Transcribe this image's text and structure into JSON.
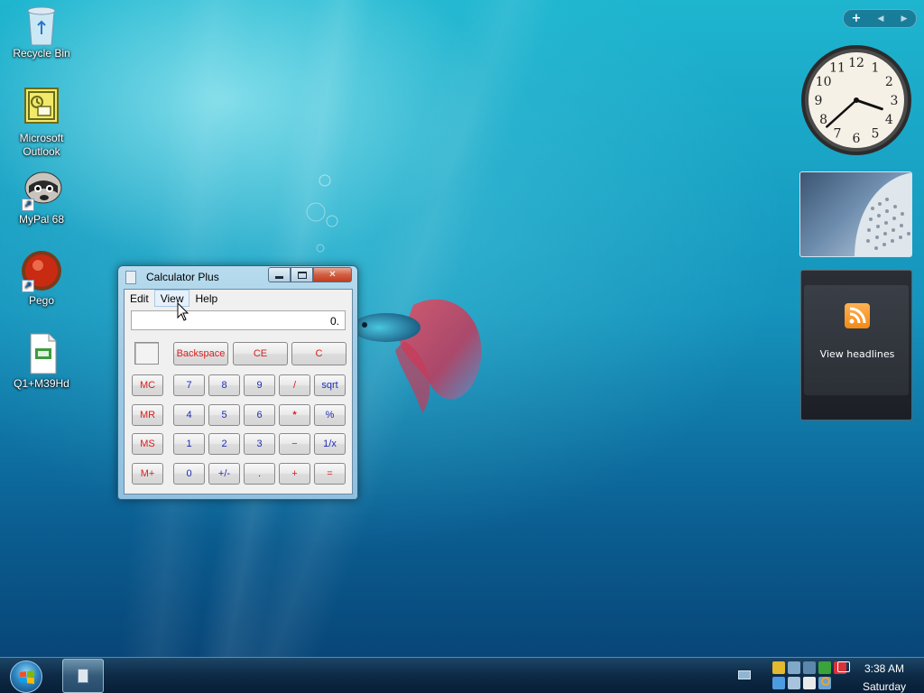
{
  "desktop": {
    "icons": [
      {
        "label": "Recycle Bin",
        "icon": "recycle-bin-icon"
      },
      {
        "label": "Microsoft Outlook",
        "icon": "outlook-icon"
      },
      {
        "label": "MyPal 68",
        "icon": "mypal-raccoon-icon"
      },
      {
        "label": "Pego",
        "icon": "pego-icon"
      },
      {
        "label": "Q1+M39Hd",
        "icon": "document-icon"
      }
    ]
  },
  "calculator": {
    "title": "Calculator Plus",
    "menu": [
      "Edit",
      "View",
      "Help"
    ],
    "display": "0.",
    "top_buttons": [
      "Backspace",
      "CE",
      "C"
    ],
    "memory_buttons": [
      "MC",
      "MR",
      "MS",
      "M+"
    ],
    "rows": [
      [
        "7",
        "8",
        "9",
        "/",
        "sqrt"
      ],
      [
        "4",
        "5",
        "6",
        "*",
        "%"
      ],
      [
        "1",
        "2",
        "3",
        "−",
        "1/x"
      ],
      [
        "0",
        "+/-",
        ".",
        "+",
        "="
      ]
    ],
    "caption": {
      "minimize": "minimize-icon",
      "maximize": "maximize-icon",
      "close": "close-icon"
    }
  },
  "gadgets": {
    "clock": {
      "hour": 3,
      "minute": 38
    },
    "clock_numbers": [
      "12",
      "1",
      "2",
      "3",
      "4",
      "5",
      "6",
      "7",
      "8",
      "9",
      "10",
      "11"
    ],
    "feed": {
      "label": "View headlines"
    }
  },
  "taskbar": {
    "time": "3:38 AM",
    "day": "Saturday"
  },
  "colors": {
    "accent_red": "#d62020",
    "accent_blue": "#1d2db8"
  }
}
